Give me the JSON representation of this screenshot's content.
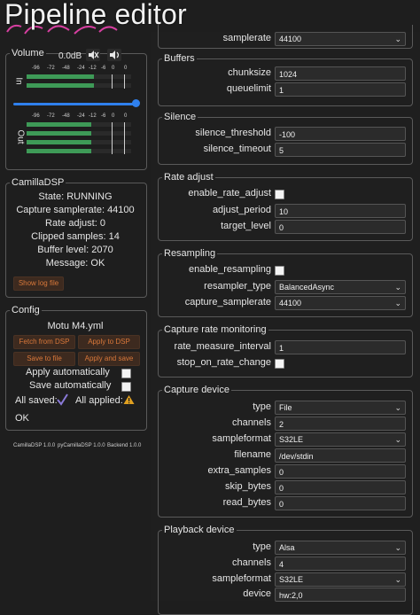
{
  "header": {
    "title": "Pipeline editor"
  },
  "volume": {
    "legend": "Volume",
    "level": "0.0dB",
    "tick_labels": [
      "-96",
      "-72",
      "-48",
      "-24",
      "-12",
      "-6",
      "0",
      "0"
    ],
    "in_label": "In",
    "out_label": "Out",
    "mute_icon": "speaker-muted-icon",
    "unmute_icon": "speaker-icon",
    "slider_value": 1.0,
    "in_levels": [
      0.64,
      0.64
    ],
    "out_levels": [
      0.62,
      0.62,
      0.62,
      0.62
    ]
  },
  "cdsp": {
    "legend": "CamillaDSP",
    "rows": [
      {
        "label": "State:",
        "value": "RUNNING"
      },
      {
        "label": "Capture samplerate:",
        "value": "44100"
      },
      {
        "label": "Rate adjust:",
        "value": "0"
      },
      {
        "label": "Clipped samples:",
        "value": "14"
      },
      {
        "label": "Buffer level:",
        "value": "2070"
      },
      {
        "label": "Message:",
        "value": "OK"
      }
    ],
    "log_button": "Show log file"
  },
  "config": {
    "legend": "Config",
    "file": "Motu M4.yml",
    "fetch": "Fetch from DSP",
    "apply": "Apply to DSP",
    "save": "Save to file",
    "apply_save": "Apply and save",
    "apply_auto": "Apply automatically",
    "save_auto": "Save automatically",
    "all_saved": "All saved:",
    "all_applied": "All applied:",
    "ok": "OK"
  },
  "versions": {
    "camilladsp": "CamillaDSP 1.0.0",
    "pycamilladsp": "pyCamillaDSP 1.0.0",
    "backend": "Backend 1.0.0"
  },
  "devices": {
    "samplerate_label": "samplerate",
    "samplerate_value": "44100",
    "buffers": {
      "legend": "Buffers",
      "chunksize_label": "chunksize",
      "chunksize": "1024",
      "queuelimit_label": "queuelimit",
      "queuelimit": "1"
    },
    "silence": {
      "legend": "Silence",
      "threshold_label": "silence_threshold",
      "threshold": "-100",
      "timeout_label": "silence_timeout",
      "timeout": "5"
    },
    "rate_adjust": {
      "legend": "Rate adjust",
      "enable_label": "enable_rate_adjust",
      "period_label": "adjust_period",
      "period": "10",
      "target_label": "target_level",
      "target": "0"
    },
    "resampling": {
      "legend": "Resampling",
      "enable_label": "enable_resampling",
      "type_label": "resampler_type",
      "type": "BalancedAsync",
      "cap_sr_label": "capture_samplerate",
      "cap_sr": "44100"
    },
    "rate_monitor": {
      "legend": "Capture rate monitoring",
      "interval_label": "rate_measure_interval",
      "interval": "1",
      "stop_label": "stop_on_rate_change"
    },
    "capture": {
      "legend": "Capture device",
      "type_label": "type",
      "type": "File",
      "channels_label": "channels",
      "channels": "2",
      "format_label": "sampleformat",
      "format": "S32LE",
      "filename_label": "filename",
      "filename": "/dev/stdin",
      "extra_label": "extra_samples",
      "extra": "0",
      "skip_label": "skip_bytes",
      "skip": "0",
      "read_label": "read_bytes",
      "read": "0"
    },
    "playback": {
      "legend": "Playback device",
      "type_label": "type",
      "type": "Alsa",
      "channels_label": "channels",
      "channels": "4",
      "format_label": "sampleformat",
      "format": "S32LE",
      "device_label": "device",
      "device": "hw:2,0"
    }
  },
  "colors": {
    "accent": "#d9783a",
    "meter": "#3e9a57",
    "slider": "#2f80ed",
    "warn": "#e0a020",
    "check": "#8a7ad8"
  }
}
